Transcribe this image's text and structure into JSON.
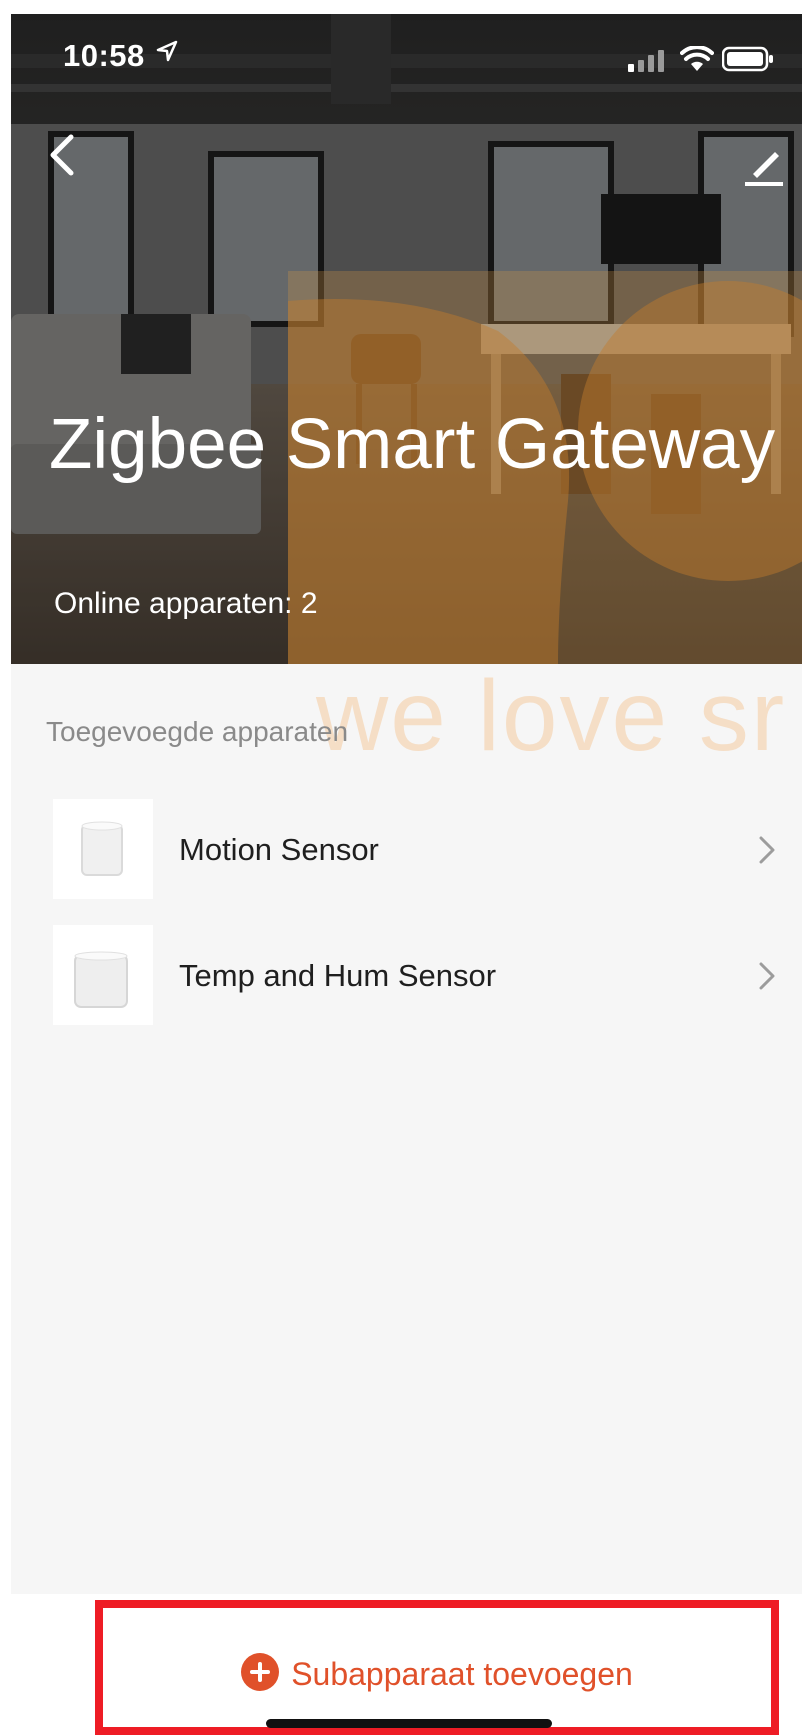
{
  "status_bar": {
    "time": "10:58",
    "location_icon": "location-arrow-icon",
    "signal_icon": "cellular-signal-icon",
    "wifi_icon": "wifi-icon",
    "battery_icon": "battery-icon"
  },
  "header": {
    "back_icon": "chevron-left-icon",
    "edit_icon": "pencil-icon",
    "title": "Zigbee Smart Gateway",
    "online_devices": "Online apparaten: 2"
  },
  "watermark": {
    "text": "we love sr"
  },
  "devices_section": {
    "label": "Toegevoegde apparaten",
    "items": [
      {
        "name": "Motion Sensor",
        "icon": "chevron-right-icon"
      },
      {
        "name": "Temp and Hum Sensor",
        "icon": "chevron-right-icon"
      }
    ]
  },
  "add_button": {
    "label": "Subapparaat toevoegen",
    "icon": "plus-circle-icon"
  },
  "colors": {
    "accent": "#e0512a",
    "highlight_border": "#ee1c25",
    "background": "#f6f6f6"
  }
}
